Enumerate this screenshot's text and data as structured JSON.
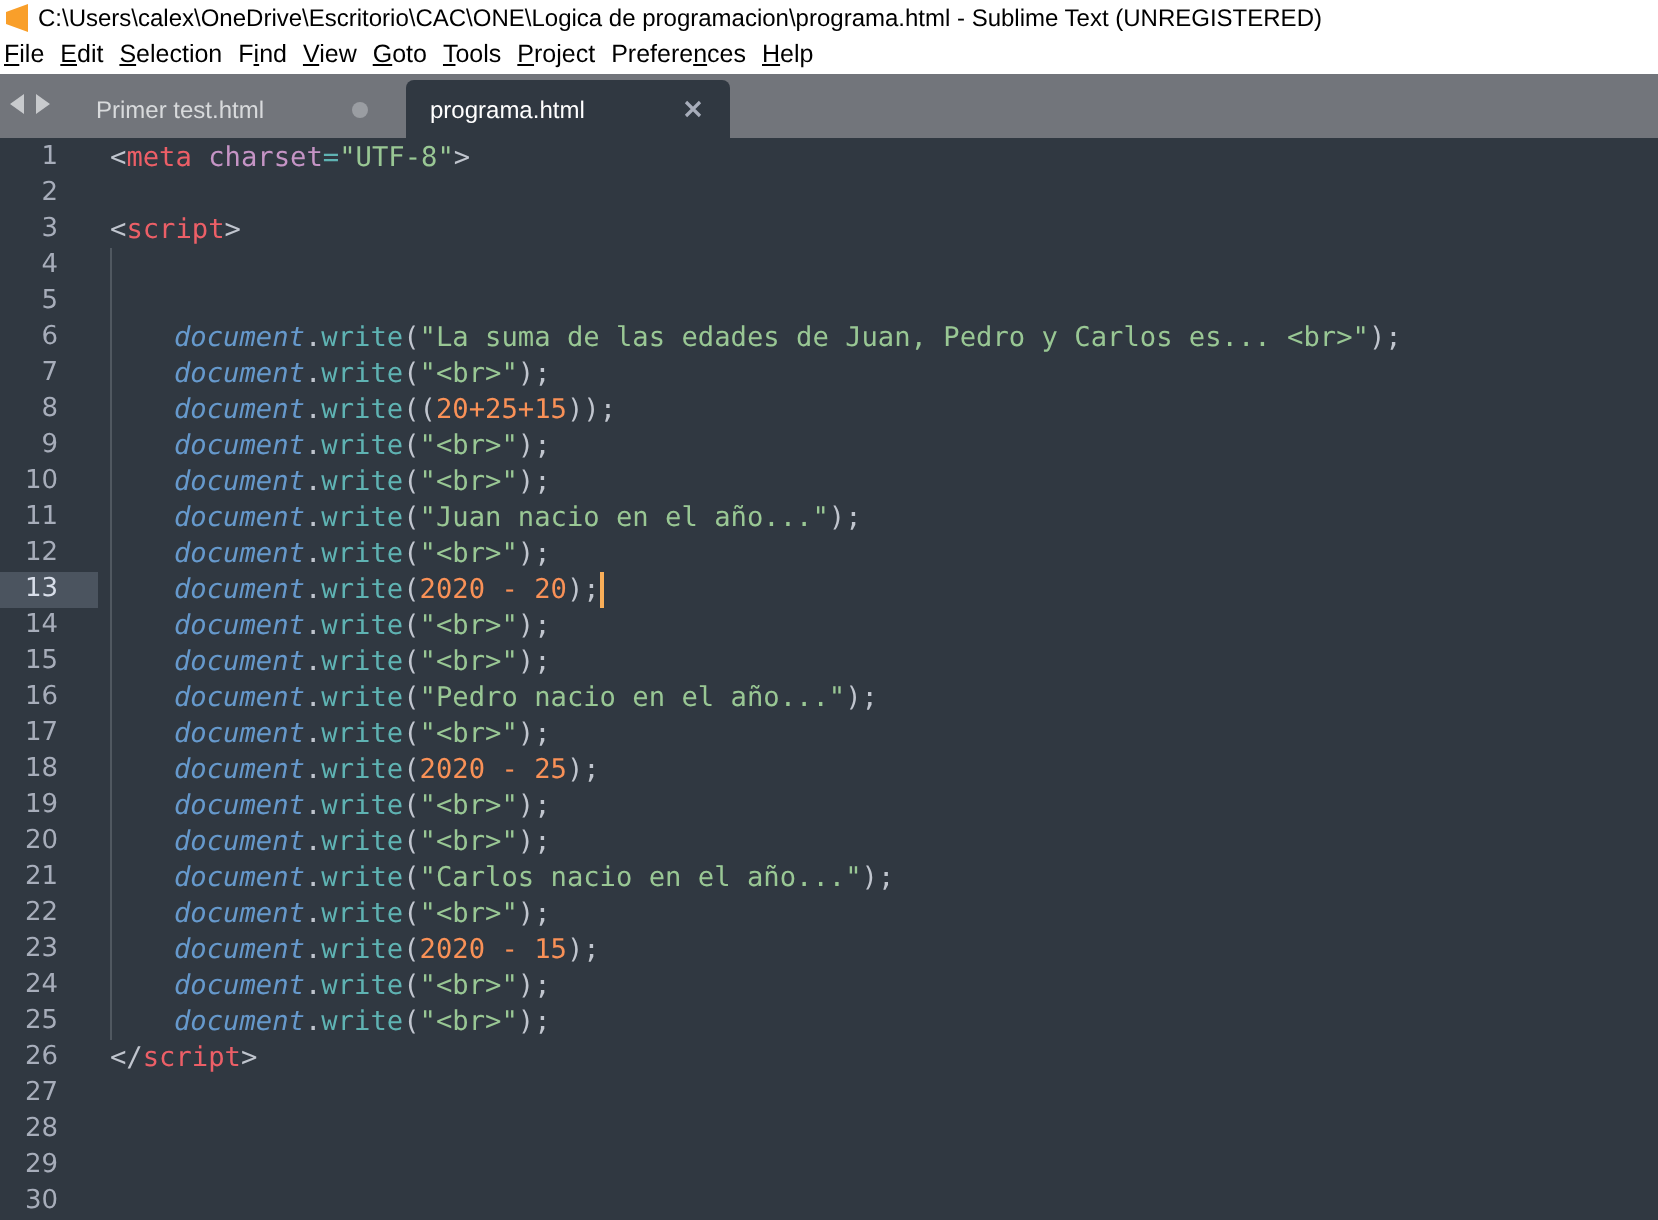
{
  "window": {
    "title": "C:\\Users\\calex\\OneDrive\\Escritorio\\CAC\\ONE\\Logica de programacion\\programa.html - Sublime Text (UNREGISTERED)"
  },
  "menu": [
    {
      "key": "F",
      "post": "ile"
    },
    {
      "key": "E",
      "post": "dit"
    },
    {
      "key": "S",
      "post": "election"
    },
    {
      "pre": "F",
      "key": "i",
      "post": "nd"
    },
    {
      "key": "V",
      "post": "iew"
    },
    {
      "key": "G",
      "post": "oto"
    },
    {
      "key": "T",
      "post": "ools"
    },
    {
      "key": "P",
      "post": "roject"
    },
    {
      "pre": "Prefere",
      "key": "n",
      "post": "ces"
    },
    {
      "key": "H",
      "post": "elp"
    }
  ],
  "tabs": [
    {
      "label": "Primer test.html",
      "selected": false,
      "modified": true
    },
    {
      "label": "programa.html",
      "selected": true,
      "modified": false
    }
  ],
  "lines": [
    {
      "number": "1",
      "indented": false,
      "current": false,
      "tokens": [
        {
          "kind": "punct",
          "text": "<"
        },
        {
          "kind": "tag",
          "text": "meta"
        },
        {
          "kind": "attr",
          "text": " charset"
        },
        {
          "kind": "method",
          "text": "="
        },
        {
          "kind": "string",
          "text": "\"UTF-8\""
        },
        {
          "kind": "punct",
          "text": ">"
        }
      ]
    },
    {
      "number": "2",
      "indented": false,
      "current": false
    },
    {
      "number": "3",
      "indented": false,
      "current": false,
      "tokens": [
        {
          "kind": "punct",
          "text": "<"
        },
        {
          "kind": "tag",
          "text": "script"
        },
        {
          "kind": "punct",
          "text": ">"
        }
      ]
    },
    {
      "number": "4",
      "indented": true,
      "current": false
    },
    {
      "number": "5",
      "indented": true,
      "current": false
    },
    {
      "number": "6",
      "indented": true,
      "current": false,
      "tokens": [
        {
          "kind": "obj",
          "text": "document"
        },
        {
          "kind": "punct",
          "text": "."
        },
        {
          "kind": "method",
          "text": "write"
        },
        {
          "kind": "punct",
          "text": "("
        },
        {
          "kind": "string",
          "text": "\"La suma de las edades de Juan, Pedro y Carlos es... <br>\""
        },
        {
          "kind": "punct",
          "text": ");"
        }
      ]
    },
    {
      "number": "7",
      "indented": true,
      "current": false,
      "tokens": [
        {
          "kind": "obj",
          "text": "document"
        },
        {
          "kind": "punct",
          "text": "."
        },
        {
          "kind": "method",
          "text": "write"
        },
        {
          "kind": "punct",
          "text": "("
        },
        {
          "kind": "string",
          "text": "\"<br>\""
        },
        {
          "kind": "punct",
          "text": ");"
        }
      ]
    },
    {
      "number": "8",
      "indented": true,
      "current": false,
      "tokens": [
        {
          "kind": "obj",
          "text": "document"
        },
        {
          "kind": "punct",
          "text": "."
        },
        {
          "kind": "method",
          "text": "write"
        },
        {
          "kind": "punct",
          "text": "(("
        },
        {
          "kind": "number",
          "text": "20"
        },
        {
          "kind": "operator",
          "text": "+"
        },
        {
          "kind": "number",
          "text": "25"
        },
        {
          "kind": "operator",
          "text": "+"
        },
        {
          "kind": "number",
          "text": "15"
        },
        {
          "kind": "punct",
          "text": "));"
        }
      ]
    },
    {
      "number": "9",
      "indented": true,
      "current": false,
      "tokens": [
        {
          "kind": "obj",
          "text": "document"
        },
        {
          "kind": "punct",
          "text": "."
        },
        {
          "kind": "method",
          "text": "write"
        },
        {
          "kind": "punct",
          "text": "("
        },
        {
          "kind": "string",
          "text": "\"<br>\""
        },
        {
          "kind": "punct",
          "text": ");"
        }
      ]
    },
    {
      "number": "10",
      "indented": true,
      "current": false,
      "tokens": [
        {
          "kind": "obj",
          "text": "document"
        },
        {
          "kind": "punct",
          "text": "."
        },
        {
          "kind": "method",
          "text": "write"
        },
        {
          "kind": "punct",
          "text": "("
        },
        {
          "kind": "string",
          "text": "\"<br>\""
        },
        {
          "kind": "punct",
          "text": ");"
        }
      ]
    },
    {
      "number": "11",
      "indented": true,
      "current": false,
      "tokens": [
        {
          "kind": "obj",
          "text": "document"
        },
        {
          "kind": "punct",
          "text": "."
        },
        {
          "kind": "method",
          "text": "write"
        },
        {
          "kind": "punct",
          "text": "("
        },
        {
          "kind": "string",
          "text": "\"Juan nacio en el año...\""
        },
        {
          "kind": "punct",
          "text": ");"
        }
      ]
    },
    {
      "number": "12",
      "indented": true,
      "current": false,
      "tokens": [
        {
          "kind": "obj",
          "text": "document"
        },
        {
          "kind": "punct",
          "text": "."
        },
        {
          "kind": "method",
          "text": "write"
        },
        {
          "kind": "punct",
          "text": "("
        },
        {
          "kind": "string",
          "text": "\"<br>\""
        },
        {
          "kind": "punct",
          "text": ");"
        }
      ]
    },
    {
      "number": "13",
      "indented": true,
      "current": true,
      "tokens": [
        {
          "kind": "obj",
          "text": "document"
        },
        {
          "kind": "punct",
          "text": "."
        },
        {
          "kind": "method",
          "text": "write"
        },
        {
          "kind": "punct",
          "text": "("
        },
        {
          "kind": "number",
          "text": "2020"
        },
        {
          "kind": "operator",
          "text": " - "
        },
        {
          "kind": "number",
          "text": "20"
        },
        {
          "kind": "punct",
          "text": ");"
        }
      ]
    },
    {
      "number": "14",
      "indented": true,
      "current": false,
      "tokens": [
        {
          "kind": "obj",
          "text": "document"
        },
        {
          "kind": "punct",
          "text": "."
        },
        {
          "kind": "method",
          "text": "write"
        },
        {
          "kind": "punct",
          "text": "("
        },
        {
          "kind": "string",
          "text": "\"<br>\""
        },
        {
          "kind": "punct",
          "text": ");"
        }
      ]
    },
    {
      "number": "15",
      "indented": true,
      "current": false,
      "tokens": [
        {
          "kind": "obj",
          "text": "document"
        },
        {
          "kind": "punct",
          "text": "."
        },
        {
          "kind": "method",
          "text": "write"
        },
        {
          "kind": "punct",
          "text": "("
        },
        {
          "kind": "string",
          "text": "\"<br>\""
        },
        {
          "kind": "punct",
          "text": ");"
        }
      ]
    },
    {
      "number": "16",
      "indented": true,
      "current": false,
      "tokens": [
        {
          "kind": "obj",
          "text": "document"
        },
        {
          "kind": "punct",
          "text": "."
        },
        {
          "kind": "method",
          "text": "write"
        },
        {
          "kind": "punct",
          "text": "("
        },
        {
          "kind": "string",
          "text": "\"Pedro nacio en el año...\""
        },
        {
          "kind": "punct",
          "text": ");"
        }
      ]
    },
    {
      "number": "17",
      "indented": true,
      "current": false,
      "tokens": [
        {
          "kind": "obj",
          "text": "document"
        },
        {
          "kind": "punct",
          "text": "."
        },
        {
          "kind": "method",
          "text": "write"
        },
        {
          "kind": "punct",
          "text": "("
        },
        {
          "kind": "string",
          "text": "\"<br>\""
        },
        {
          "kind": "punct",
          "text": ");"
        }
      ]
    },
    {
      "number": "18",
      "indented": true,
      "current": false,
      "tokens": [
        {
          "kind": "obj",
          "text": "document"
        },
        {
          "kind": "punct",
          "text": "."
        },
        {
          "kind": "method",
          "text": "write"
        },
        {
          "kind": "punct",
          "text": "("
        },
        {
          "kind": "number",
          "text": "2020"
        },
        {
          "kind": "operator",
          "text": " - "
        },
        {
          "kind": "number",
          "text": "25"
        },
        {
          "kind": "punct",
          "text": ");"
        }
      ]
    },
    {
      "number": "19",
      "indented": true,
      "current": false,
      "tokens": [
        {
          "kind": "obj",
          "text": "document"
        },
        {
          "kind": "punct",
          "text": "."
        },
        {
          "kind": "method",
          "text": "write"
        },
        {
          "kind": "punct",
          "text": "("
        },
        {
          "kind": "string",
          "text": "\"<br>\""
        },
        {
          "kind": "punct",
          "text": ");"
        }
      ]
    },
    {
      "number": "20",
      "indented": true,
      "current": false,
      "tokens": [
        {
          "kind": "obj",
          "text": "document"
        },
        {
          "kind": "punct",
          "text": "."
        },
        {
          "kind": "method",
          "text": "write"
        },
        {
          "kind": "punct",
          "text": "("
        },
        {
          "kind": "string",
          "text": "\"<br>\""
        },
        {
          "kind": "punct",
          "text": ");"
        }
      ]
    },
    {
      "number": "21",
      "indented": true,
      "current": false,
      "tokens": [
        {
          "kind": "obj",
          "text": "document"
        },
        {
          "kind": "punct",
          "text": "."
        },
        {
          "kind": "method",
          "text": "write"
        },
        {
          "kind": "punct",
          "text": "("
        },
        {
          "kind": "string",
          "text": "\"Carlos nacio en el año...\""
        },
        {
          "kind": "punct",
          "text": ");"
        }
      ]
    },
    {
      "number": "22",
      "indented": true,
      "current": false,
      "tokens": [
        {
          "kind": "obj",
          "text": "document"
        },
        {
          "kind": "punct",
          "text": "."
        },
        {
          "kind": "method",
          "text": "write"
        },
        {
          "kind": "punct",
          "text": "("
        },
        {
          "kind": "string",
          "text": "\"<br>\""
        },
        {
          "kind": "punct",
          "text": ");"
        }
      ]
    },
    {
      "number": "23",
      "indented": true,
      "current": false,
      "tokens": [
        {
          "kind": "obj",
          "text": "document"
        },
        {
          "kind": "punct",
          "text": "."
        },
        {
          "kind": "method",
          "text": "write"
        },
        {
          "kind": "punct",
          "text": "("
        },
        {
          "kind": "number",
          "text": "2020"
        },
        {
          "kind": "operator",
          "text": " - "
        },
        {
          "kind": "number",
          "text": "15"
        },
        {
          "kind": "punct",
          "text": ");"
        }
      ]
    },
    {
      "number": "24",
      "indented": true,
      "current": false,
      "tokens": [
        {
          "kind": "obj",
          "text": "document"
        },
        {
          "kind": "punct",
          "text": "."
        },
        {
          "kind": "method",
          "text": "write"
        },
        {
          "kind": "punct",
          "text": "("
        },
        {
          "kind": "string",
          "text": "\"<br>\""
        },
        {
          "kind": "punct",
          "text": ");"
        }
      ]
    },
    {
      "number": "25",
      "indented": true,
      "current": false,
      "tokens": [
        {
          "kind": "obj",
          "text": "document"
        },
        {
          "kind": "punct",
          "text": "."
        },
        {
          "kind": "method",
          "text": "write"
        },
        {
          "kind": "punct",
          "text": "("
        },
        {
          "kind": "string",
          "text": "\"<br>\""
        },
        {
          "kind": "punct",
          "text": ");"
        }
      ]
    },
    {
      "number": "26",
      "indented": false,
      "current": false,
      "tokens": [
        {
          "kind": "punct",
          "text": "</"
        },
        {
          "kind": "tag",
          "text": "script"
        },
        {
          "kind": "punct",
          "text": ">"
        }
      ]
    },
    {
      "number": "27",
      "indented": false,
      "current": false
    },
    {
      "number": "28",
      "indented": false,
      "current": false
    },
    {
      "number": "29",
      "indented": false,
      "current": false
    },
    {
      "number": "30",
      "indented": false,
      "current": false
    }
  ]
}
